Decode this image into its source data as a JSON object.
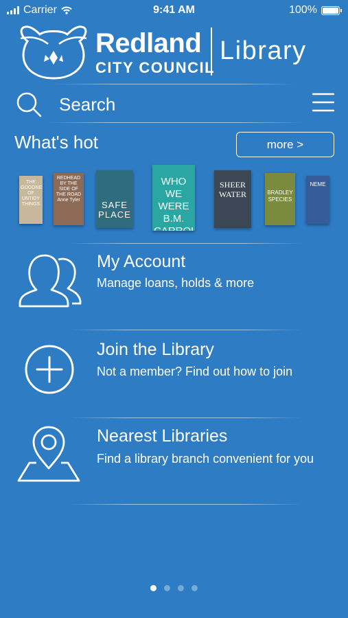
{
  "status_bar": {
    "carrier": "Carrier",
    "time": "9:41 AM",
    "battery": "100%",
    "battery_level": 1.0
  },
  "brand": {
    "name": "Redland",
    "subname": "CITY COUNCIL",
    "product": "Library"
  },
  "search": {
    "placeholder": "Search",
    "icon": "search-icon"
  },
  "menu": {
    "icon": "hamburger-menu-icon"
  },
  "whats_hot": {
    "title": "What's hot",
    "more_label": "more >",
    "books": [
      {
        "cover_text": "THE GOODNESS OF UNTIDY THINGS",
        "cover_color": "#c8b79a"
      },
      {
        "cover_text": "REDHEAD BY THE SIDE OF THE ROAD Anne Tyler",
        "cover_color": "#8d6a55"
      },
      {
        "cover_text": "SAFE PLACE",
        "cover_color": "#2f6d7e"
      },
      {
        "cover_text": "WHO WE WERE B.M. CARROLL",
        "cover_color": "#2aa6a3"
      },
      {
        "cover_text": "SHEER WATER",
        "cover_color": "#3c4756"
      },
      {
        "cover_text": "BRADLEY SPECIES",
        "cover_color": "#7c8a3e"
      },
      {
        "cover_text": "NEME",
        "cover_color": "#355c99"
      }
    ]
  },
  "menu_items": [
    {
      "title": "My Account",
      "subtitle": "Manage loans, holds & more",
      "icon": "users-icon"
    },
    {
      "title": "Join the Library",
      "subtitle": "Not a member? Find out how to join",
      "icon": "plus-circle-icon"
    },
    {
      "title": "Nearest Libraries",
      "subtitle": "Find a library branch convenient for you",
      "icon": "map-pin-icon"
    }
  ],
  "pagination": {
    "count": 4,
    "active": 1
  },
  "colors": {
    "background": "#2e7cc4",
    "foreground": "#ffffff"
  }
}
